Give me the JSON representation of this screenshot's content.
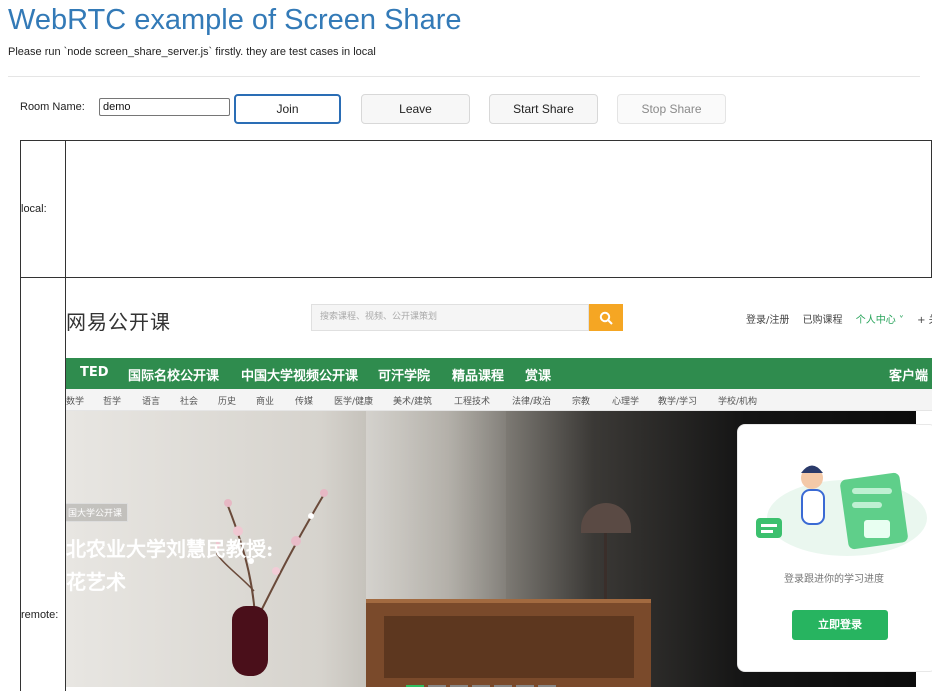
{
  "header": {
    "title": "WebRTC example of Screen Share",
    "subtitle": "Please run `node screen_share_server.js` firstly. they are test cases in local"
  },
  "controls": {
    "room_label": "Room Name:",
    "room_value": "demo",
    "join_label": "Join",
    "leave_label": "Leave",
    "start_share_label": "Start Share",
    "stop_share_label": "Stop Share"
  },
  "videos": {
    "local_label": "local:",
    "remote_label": "remote:"
  },
  "shared_screen": {
    "logo": "网易公开课",
    "search_placeholder": "搜索课程、视频、公开课策划",
    "search_icon": "search-icon",
    "user_links": [
      "登录/注册",
      "已购课程",
      "个人中心 ˅",
      "+ 关"
    ],
    "nav": [
      "TED",
      "国际名校公开课",
      "中国大学视频公开课",
      "可汗学院",
      "精品课程",
      "赏课"
    ],
    "client_label": "客户端",
    "subnav": [
      "数学",
      "哲学",
      "语言",
      "社会",
      "历史",
      "商业",
      "传媒",
      "医学/健康",
      "美术/建筑",
      "工程技术",
      "法律/政治",
      "宗教",
      "心理学",
      "教学/学习",
      "学校/机构"
    ],
    "hero_tag": "国大学公开课",
    "hero_title_line1": "北农业大学刘慧民教授:",
    "hero_title_line2": "花艺术",
    "login_prompt": "登录跟进你的学习进度",
    "login_button": "立即登录",
    "colors": {
      "nav_green": "#2f8c4e",
      "search_orange": "#f5a623",
      "login_green": "#27b460"
    }
  }
}
